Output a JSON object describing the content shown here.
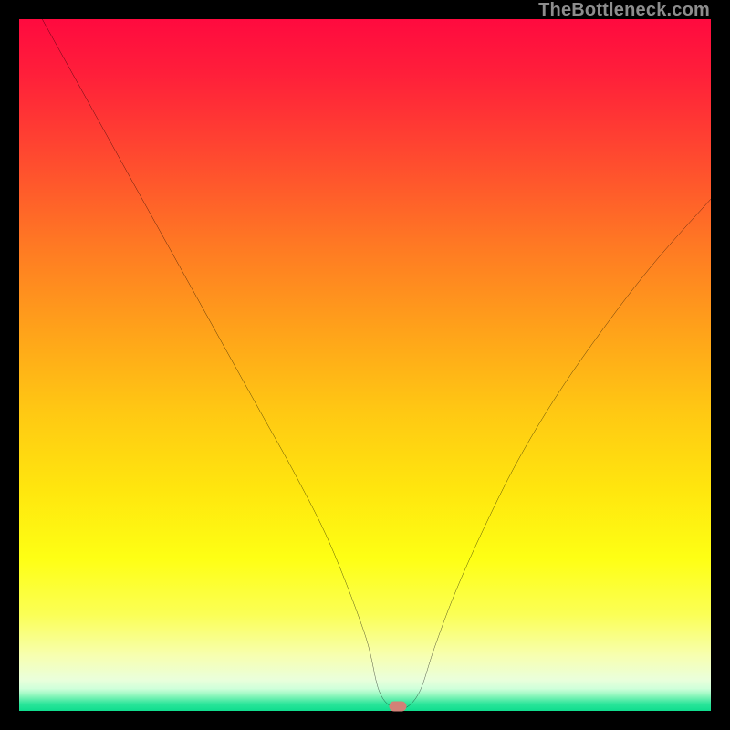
{
  "watermark": "TheBottleneck.com",
  "colors": {
    "frame": "#000000",
    "marker": "#d38177",
    "curve": "#000000",
    "watermark": "#8d8d8d"
  },
  "marker": {
    "x_pct": 54.7,
    "y_pct": 99.3
  },
  "chart_data": {
    "type": "line",
    "title": "",
    "xlabel": "",
    "ylabel": "",
    "xlim": [
      0,
      100
    ],
    "ylim": [
      0,
      100
    ],
    "grid": false,
    "legend": false,
    "series": [
      {
        "name": "bottleneck-curve",
        "x": [
          0,
          5,
          10,
          15,
          20,
          25,
          30,
          35,
          40,
          45,
          50,
          52,
          54,
          56,
          58,
          60,
          63,
          67,
          72,
          78,
          85,
          92,
          100
        ],
        "y": [
          106,
          97,
          88,
          79,
          70,
          61,
          52,
          43,
          34,
          24,
          11,
          3,
          0.5,
          0.5,
          3,
          9,
          17,
          26,
          36,
          46,
          56,
          65,
          74
        ]
      }
    ],
    "annotations": [
      {
        "type": "marker",
        "x": 54.7,
        "y": 0.7,
        "shape": "pill",
        "color": "#d38177"
      }
    ],
    "background_gradient": {
      "direction": "vertical",
      "stops": [
        {
          "pct": 0,
          "color": "#ff0a3f"
        },
        {
          "pct": 20,
          "color": "#ff4a2f"
        },
        {
          "pct": 45,
          "color": "#ffa21a"
        },
        {
          "pct": 68,
          "color": "#ffe60e"
        },
        {
          "pct": 86,
          "color": "#fbff55"
        },
        {
          "pct": 96,
          "color": "#eaffdb"
        },
        {
          "pct": 100,
          "color": "#0fdd8e"
        }
      ]
    }
  }
}
